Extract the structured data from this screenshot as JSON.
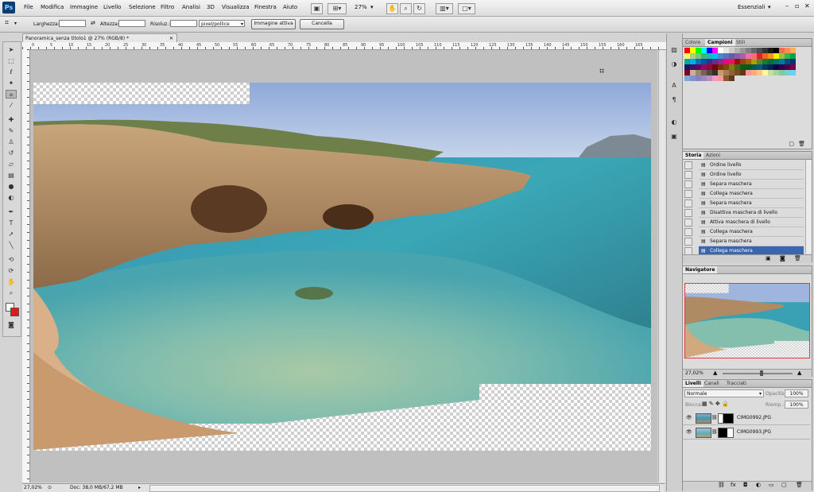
{
  "app": {
    "logo": "Ps",
    "workspace": "Essenziali"
  },
  "menu": [
    "File",
    "Modifica",
    "Immagine",
    "Livello",
    "Selezione",
    "Filtro",
    "Analisi",
    "3D",
    "Visualizza",
    "Finestra",
    "Aiuto"
  ],
  "toolbar": {
    "zoom": "27%"
  },
  "options_bar": {
    "width_label": "Larghezza:",
    "height_label": "Altezza:",
    "resolution_label": "Risoluz.:",
    "unit_select": "pixel/pollice",
    "front_image_button": "Immagine attiva",
    "clear_button": "Cancella"
  },
  "document": {
    "tab_title": "Panoramica_senza titolo1 @ 27% (RGB/8) *",
    "ruler_numbers": [
      "0",
      "5",
      "10",
      "15",
      "20",
      "25",
      "30",
      "35",
      "40",
      "45",
      "50",
      "55",
      "60",
      "65",
      "70",
      "75",
      "80",
      "85",
      "90",
      "95",
      "100",
      "105",
      "110",
      "115",
      "120",
      "125",
      "130",
      "135",
      "140",
      "145",
      "150",
      "155",
      "160",
      "165"
    ]
  },
  "status": {
    "zoom": "27,02%",
    "doc_info": "Doc: 38,0 MB/67,2 MB"
  },
  "swatches_panel": {
    "tabs": [
      "Colore",
      "Campioni",
      "Stili"
    ],
    "active_tab": "Campioni",
    "colors": [
      "#ff0000",
      "#ffff00",
      "#00ff00",
      "#00ffff",
      "#0000ff",
      "#ff00ff",
      "#ffffff",
      "#e6e6e6",
      "#cccccc",
      "#b3b3b3",
      "#999999",
      "#808080",
      "#666666",
      "#4d4d4d",
      "#333333",
      "#1a1a1a",
      "#000000",
      "#f26c4f",
      "#f68e56",
      "#fbaf5d",
      "#fff568",
      "#acd372",
      "#7cc576",
      "#3bb878",
      "#1abbb4",
      "#00bff3",
      "#438ccb",
      "#5574b9",
      "#605ca8",
      "#855fa8",
      "#a763a8",
      "#f06eaa",
      "#f26d7d",
      "#ed1c24",
      "#f26522",
      "#f7941d",
      "#fff200",
      "#8dc63f",
      "#39b54a",
      "#00a651",
      "#00a99d",
      "#00aeef",
      "#0072bc",
      "#0054a6",
      "#2e3192",
      "#662d91",
      "#92278f",
      "#ec008c",
      "#ed145b",
      "#9e0b0f",
      "#a0410d",
      "#a36209",
      "#aba000",
      "#598527",
      "#197b30",
      "#007236",
      "#00746b",
      "#0076a3",
      "#004b80",
      "#003471",
      "#1b1464",
      "#440e62",
      "#630460",
      "#9e005d",
      "#9e0039",
      "#790000",
      "#7b2e00",
      "#7d4900",
      "#827b00",
      "#406618",
      "#005e20",
      "#005826",
      "#005952",
      "#005b7f",
      "#003663",
      "#002157",
      "#0d004c",
      "#32004b",
      "#4b0049",
      "#7b0046",
      "#7a0026",
      "#c7b299",
      "#998675",
      "#736357",
      "#534741",
      "#37302a",
      "#c69c6d",
      "#a67c52",
      "#8c6239",
      "#754c24",
      "#603913",
      "#f5989d",
      "#f9ad81",
      "#fdc68a",
      "#fff79a",
      "#c4df9b",
      "#a3d39c",
      "#82ca9d",
      "#7bcdc8",
      "#6dcff6",
      "#7da7d9",
      "#8393ca",
      "#8781bd",
      "#a187be",
      "#bd8cbf",
      "#f49ac1",
      "#f6989d",
      "#8a5a2b",
      "#5c3a1a"
    ]
  },
  "history_panel": {
    "tabs": [
      "Storia",
      "Azioni"
    ],
    "items": [
      "Ordine livello",
      "Ordine livello",
      "Separa maschera",
      "Collega maschera",
      "Separa maschera",
      "Disattiva maschera di livello",
      "Attiva maschera di livello",
      "Collega maschera",
      "Separa maschera",
      "Collega maschera"
    ],
    "selected_index": 9
  },
  "navigator_panel": {
    "tab": "Navigatore",
    "zoom": "27,02%"
  },
  "layers_panel": {
    "tabs": [
      "Livelli",
      "Canali",
      "Tracciati"
    ],
    "blend_mode": "Normale",
    "opacity_label": "Opacità:",
    "opacity_value": "100%",
    "lock_label": "Blocca:",
    "fill_label": "Riemp.:",
    "fill_value": "100%",
    "layers": [
      {
        "name": "CIMG0992.JPG"
      },
      {
        "name": "CIMG0993.JPG"
      }
    ]
  }
}
